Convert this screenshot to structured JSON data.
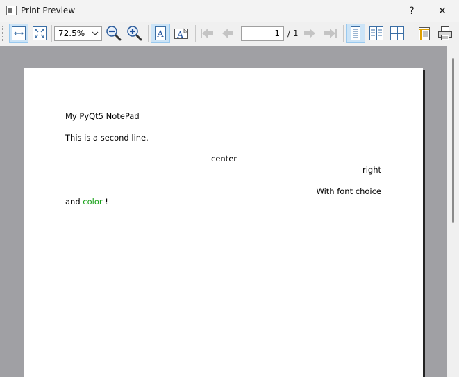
{
  "window": {
    "title": "Print Preview",
    "help_label": "?",
    "close_label": "✕"
  },
  "toolbar": {
    "zoom_value": "72.5%",
    "current_page": "1",
    "page_total": "/ 1",
    "icons": [
      "fit-width-icon",
      "fit-page-icon",
      "zoom-out-icon",
      "zoom-in-icon",
      "portrait-icon",
      "landscape-icon",
      "first-page-icon",
      "previous-page-icon",
      "next-page-icon",
      "last-page-icon",
      "single-page-icon",
      "facing-pages-icon",
      "all-pages-icon",
      "page-setup-icon",
      "print-icon"
    ]
  },
  "document": {
    "line1": "My PyQt5 NotePad",
    "line2": "This is a second line.",
    "line3": "center",
    "line4": "right",
    "line5": "With font choice",
    "line6_a": "and ",
    "line6_b": "color",
    "line6_c": " !"
  },
  "colors": {
    "accent": "#15a015",
    "active_button_bg": "#cce4f7",
    "preview_background": "#a0a0a4"
  }
}
